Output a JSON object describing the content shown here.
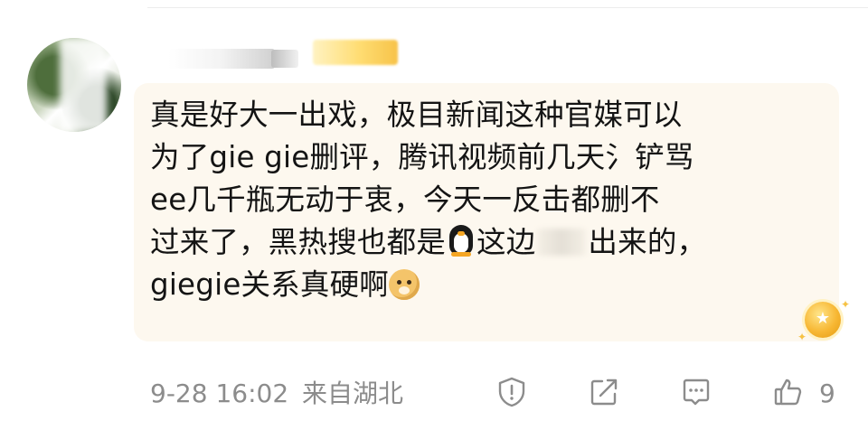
{
  "comment": {
    "username": "",
    "fan_badge": "",
    "text_lines": [
      "真是好大一出戏，极目新闻这种官媒可以",
      "为了gie gie删评，腾讯视频前几天氵铲骂",
      "ee几千瓶无动于衷，今天一反击都删不",
      "过来了，黑热搜也都是",
      "这边",
      "出来的，",
      "giegie关系真硬啊"
    ],
    "timestamp": "9-28 16:02",
    "location": "来自湖北",
    "like_count": "9"
  },
  "icons": {
    "emoji_1": "penguin-emoji",
    "emoji_2": "doge-emoji",
    "report": "report-shield-icon",
    "share": "share-edit-icon",
    "reply": "reply-comment-icon",
    "like": "thumbs-up-icon",
    "level": "gold-level-badge"
  },
  "colors": {
    "bubble_bg": "#fdf8ef",
    "text": "#141414",
    "meta": "#8c8c8c",
    "badge_gold": "#f7b733"
  }
}
